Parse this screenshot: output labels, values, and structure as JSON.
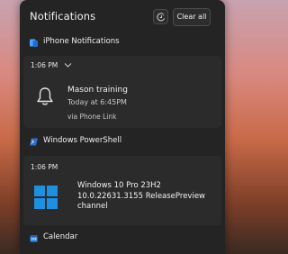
{
  "panel": {
    "title": "Notifications",
    "clear_all_label": "Clear all",
    "focus_icon": "focus-assist-icon"
  },
  "groups": [
    {
      "app_name": "iPhone Notifications",
      "app_icon": "phone-link-icon",
      "time": "1:06 PM",
      "notification": {
        "icon": "bell-icon",
        "title": "Mason training",
        "line": "Today at 6:45PM",
        "source": "via Phone Link"
      }
    },
    {
      "app_name": "Windows PowerShell",
      "app_icon": "powershell-icon",
      "time": "1:06 PM",
      "notification": {
        "icon": "windows-logo-icon",
        "body_lines": [
          "Windows 10 Pro 23H2",
          "10.0.22631.3155 ReleasePreview",
          "channel"
        ]
      }
    },
    {
      "app_name": "Calendar",
      "app_icon": "calendar-icon"
    }
  ],
  "colors": {
    "panel_bg": "#242424",
    "card_bg": "#2b2b2b",
    "windows_blue": "#1f8fe0"
  }
}
